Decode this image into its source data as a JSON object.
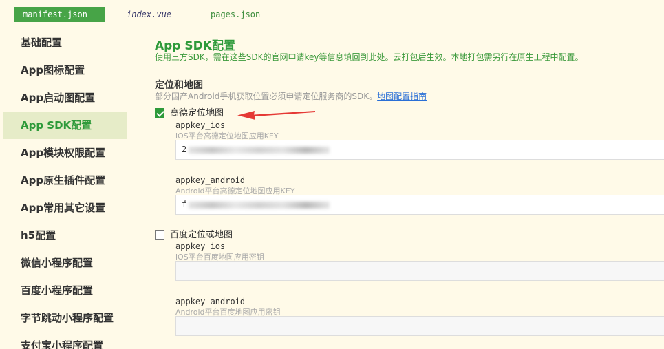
{
  "tabs": [
    {
      "label": "manifest.json",
      "active": true
    },
    {
      "label": "index.vue",
      "active": false
    },
    {
      "label": "pages.json",
      "active": false
    }
  ],
  "sidebar": {
    "items": [
      {
        "label": "基础配置"
      },
      {
        "label": "App图标配置"
      },
      {
        "label": "App启动图配置"
      },
      {
        "label": "App SDK配置",
        "active": true
      },
      {
        "label": "App模块权限配置"
      },
      {
        "label": "App原生插件配置"
      },
      {
        "label": "App常用其它设置"
      },
      {
        "label": "h5配置"
      },
      {
        "label": "微信小程序配置"
      },
      {
        "label": "百度小程序配置"
      },
      {
        "label": "字节跳动小程序配置"
      },
      {
        "label": "支付宝小程序配置"
      }
    ]
  },
  "main": {
    "title": "App SDK配置",
    "description": "使用三方SDK，需在这些SDK的官网申请key等信息填回到此处。云打包后生效。本地打包需另行在原生工程中配置。",
    "section": {
      "title": "定位和地图",
      "description": "部分国产Android手机获取位置必须申请定位服务商的SDK。",
      "link": "地图配置指南"
    },
    "amap": {
      "label": "高德定位地图",
      "checked": true,
      "ios_label": "appkey_ios",
      "ios_hint": "iOS平台高德定位地图应用KEY",
      "ios_value": "2",
      "android_label": "appkey_android",
      "android_hint": "Android平台高德定位地图应用KEY",
      "android_value": "f"
    },
    "baidu": {
      "label": "百度定位或地图",
      "checked": false,
      "ios_label": "appkey_ios",
      "ios_hint": "iOS平台百度地图应用密钥",
      "ios_value": "",
      "android_label": "appkey_android",
      "android_hint": "Android平台百度地图应用密钥",
      "android_value": ""
    }
  },
  "colors": {
    "accent": "#2e9a3a",
    "background": "#fffae8",
    "arrow": "#e53935"
  }
}
